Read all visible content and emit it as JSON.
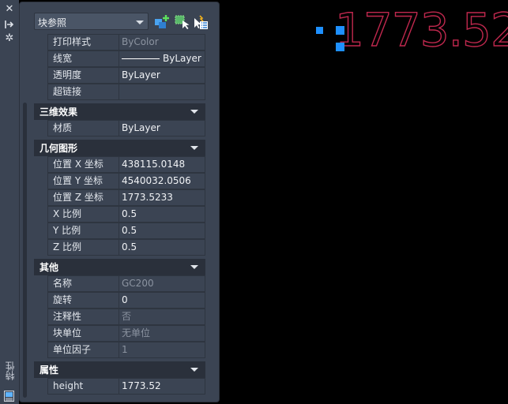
{
  "side_strip": {
    "icons": [
      "close-icon",
      "auto-hide-icon",
      "settings-icon",
      "properties-panel-icon"
    ],
    "title": "特性"
  },
  "toolbar": {
    "selection_type": "块参照",
    "buttons": [
      "toggle-pickadd-icon",
      "select-objects-icon",
      "quick-select-icon"
    ]
  },
  "general_rows": [
    {
      "label": "打印样式",
      "value": "ByColor",
      "dim": true
    },
    {
      "label": "线宽",
      "value": "ByLayer",
      "lineweight": true
    },
    {
      "label": "透明度",
      "value": "ByLayer"
    },
    {
      "label": "超链接",
      "value": ""
    }
  ],
  "sections": [
    {
      "title": "三维效果",
      "rows": [
        {
          "label": "材质",
          "value": "ByLayer"
        }
      ]
    },
    {
      "title": "几何图形",
      "rows": [
        {
          "label": "位置 X 坐标",
          "value": "438115.0148"
        },
        {
          "label": "位置 Y 坐标",
          "value": "4540032.0506"
        },
        {
          "label": "位置 Z 坐标",
          "value": "1773.5233"
        },
        {
          "label": "X 比例",
          "value": "0.5"
        },
        {
          "label": "Y 比例",
          "value": "0.5"
        },
        {
          "label": "Z 比例",
          "value": "0.5"
        }
      ]
    },
    {
      "title": "其他",
      "rows": [
        {
          "label": "名称",
          "value": "GC200",
          "dim": true
        },
        {
          "label": "旋转",
          "value": "0"
        },
        {
          "label": "注释性",
          "value": "否",
          "dim": true
        },
        {
          "label": "块单位",
          "value": "无单位",
          "dim": true
        },
        {
          "label": "单位因子",
          "value": "1",
          "dim": true
        }
      ]
    },
    {
      "title": "属性",
      "rows": [
        {
          "label": "height",
          "value": "1773.52"
        }
      ]
    }
  ],
  "canvas": {
    "text": "1773.52",
    "text_color": "#c0284e",
    "grip_color": "#1e90ff"
  }
}
